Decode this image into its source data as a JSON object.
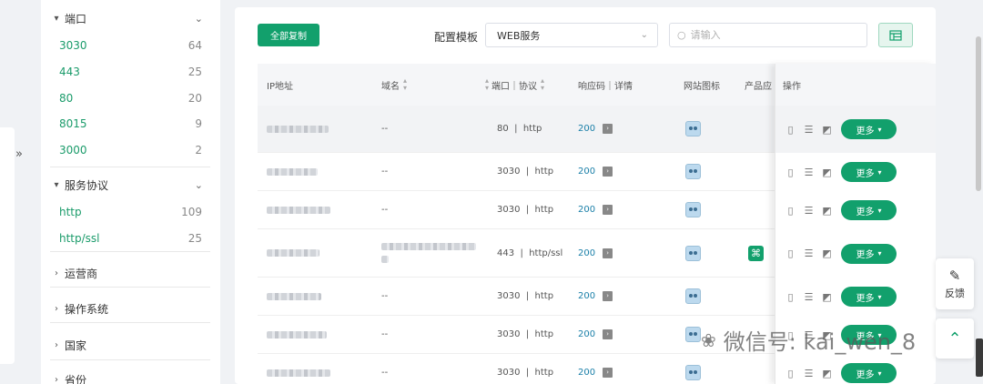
{
  "sidebar": {
    "groups": [
      {
        "title": "端口",
        "expanded": true,
        "items": [
          {
            "label": "3030",
            "count": "64"
          },
          {
            "label": "443",
            "count": "25"
          },
          {
            "label": "80",
            "count": "20"
          },
          {
            "label": "8015",
            "count": "9"
          },
          {
            "label": "3000",
            "count": "2"
          }
        ]
      },
      {
        "title": "服务协议",
        "expanded": true,
        "items": [
          {
            "label": "http",
            "count": "109"
          },
          {
            "label": "http/ssl",
            "count": "25"
          }
        ]
      },
      {
        "title": "运营商",
        "expanded": false
      },
      {
        "title": "操作系统",
        "expanded": false
      },
      {
        "title": "国家",
        "expanded": false
      },
      {
        "title": "省份",
        "expanded": false
      }
    ]
  },
  "toolbar": {
    "copy_all": "全部复制",
    "template_label": "配置模板",
    "template_value": "WEB服务",
    "search_placeholder": "请输入"
  },
  "table": {
    "headers": {
      "ip": "IP地址",
      "domain": "域名",
      "port_proto": "端口｜协议",
      "code": "响应码｜详情",
      "favicon": "网站图标",
      "product": "产品应",
      "ops": "操作"
    },
    "rows": [
      {
        "domain": "--",
        "port": "80",
        "proto": "http",
        "code": "200"
      },
      {
        "domain": "--",
        "port": "3030",
        "proto": "http",
        "code": "200"
      },
      {
        "domain": "--",
        "port": "3030",
        "proto": "http",
        "code": "200"
      },
      {
        "domain": "",
        "port": "443",
        "proto": "http/ssl",
        "code": "200"
      },
      {
        "domain": "--",
        "port": "3030",
        "proto": "http",
        "code": "200"
      },
      {
        "domain": "--",
        "port": "3030",
        "proto": "http",
        "code": "200"
      },
      {
        "domain": "--",
        "port": "3030",
        "proto": "http",
        "code": "200"
      }
    ],
    "more_label": "更多"
  },
  "floating": {
    "feedback": "反馈"
  },
  "watermark": "微信号: kai_wen_8",
  "colors": {
    "accent": "#12a06c",
    "code": "#1a7fa8"
  }
}
